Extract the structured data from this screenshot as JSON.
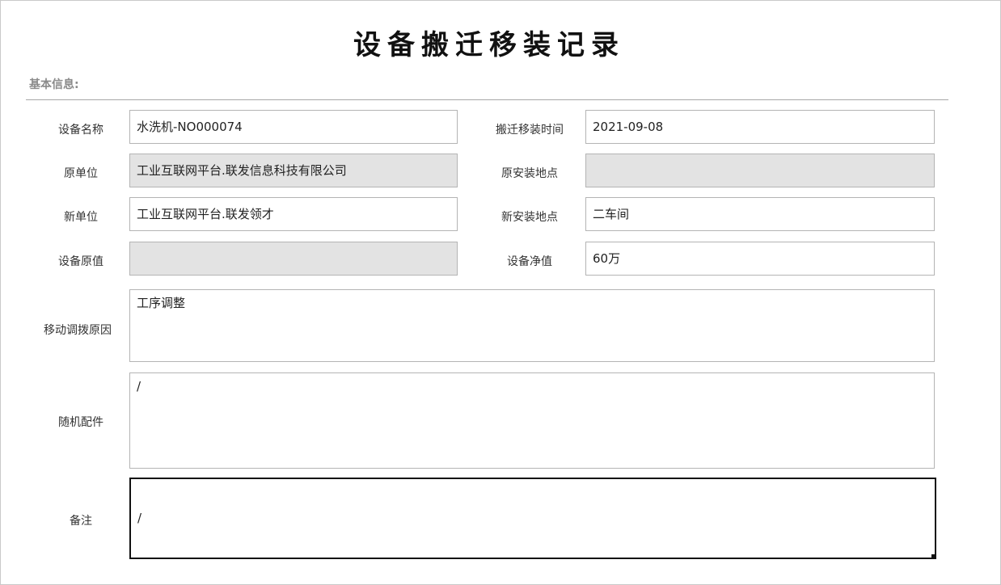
{
  "title": "设备搬迁移装记录",
  "section": "基本信息:",
  "labels": {
    "device_name": "设备名称",
    "original_unit": "原单位",
    "new_unit": "新单位",
    "original_value": "设备原值",
    "relocation_time": "搬迁移装时间",
    "original_location": "原安装地点",
    "new_location": "新安装地点",
    "net_value": "设备净值",
    "reason": "移动调拨原因",
    "accessories": "随机配件",
    "remarks": "备注"
  },
  "values": {
    "device_name": "水洗机-NO000074",
    "original_unit": "工业互联网平台.联发信息科技有限公司",
    "new_unit": "工业互联网平台.联发领才",
    "original_value": "",
    "relocation_time": "2021-09-08",
    "original_location": "",
    "new_location": "二车间",
    "net_value": "60万",
    "reason": "工序调整",
    "accessories": "/",
    "remarks": "/"
  }
}
